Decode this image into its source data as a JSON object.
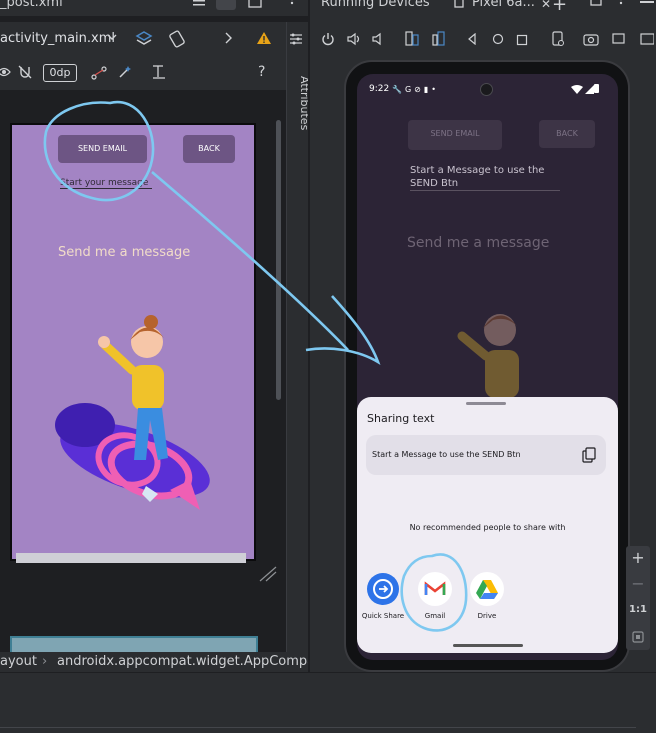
{
  "left_editor": {
    "partial_tab": "_post.xml",
    "file_tab": "activity_main.xml",
    "dp_value": "0dp",
    "attributes_label": "Attributes"
  },
  "right_panel": {
    "title": "Running Devices",
    "device_tab": "Pixel 6a..."
  },
  "design_preview": {
    "send_button": "SEND EMAIL",
    "back_button": "BACK",
    "message_hint": "Start your message",
    "heading": "Send me a message"
  },
  "device_app": {
    "status_time": "9:22",
    "send_button": "SEND EMAIL",
    "back_button": "BACK",
    "message_value": "Start a Message to use the SEND Btn",
    "heading": "Send me a message"
  },
  "share_sheet": {
    "title": "Sharing text",
    "shared_text": "Start a Message to use the SEND Btn",
    "no_recommendations": "No recommended people to share with",
    "apps": [
      {
        "label": "Quick Share",
        "icon": "quick-share-icon"
      },
      {
        "label": "Gmail",
        "icon": "gmail-icon"
      },
      {
        "label": "Drive",
        "icon": "drive-icon"
      }
    ]
  },
  "zoom_controls": {
    "plus": "+",
    "minus": "−",
    "one_to_one": "1:1"
  },
  "breadcrumb": {
    "item1": "ayout",
    "separator": "›",
    "item2": "androidx.appcompat.widget.AppCompat"
  },
  "colors": {
    "annotation": "#7ec8f0",
    "canvas_bg": "#a384c4",
    "warning": "#e8a317"
  }
}
